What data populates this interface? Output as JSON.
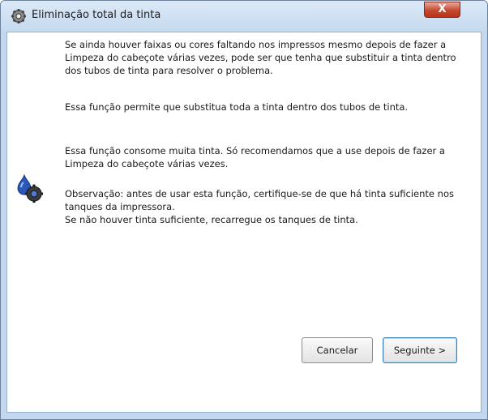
{
  "window": {
    "title": "Eliminação total da tinta",
    "close_label": "X",
    "title_icon": "printer-gear-icon"
  },
  "content": {
    "paragraph1": "Se ainda houver faixas ou cores faltando nos impressos mesmo depois de fazer a Limpeza do cabeçote várias vezes, pode ser que tenha que substituir a tinta dentro dos tubos de tinta para resolver o problema.",
    "paragraph2": "Essa função permite que substitua toda a tinta dentro dos tubos de tinta.",
    "paragraph3": "Essa função consome muita tinta. Só recomendamos que a use depois de fazer a Limpeza do cabeçote várias vezes.",
    "note_line1": "Observação: antes de usar esta função, certifique-se de que há tinta suficiente nos tanques da impressora.",
    "note_line2": "Se não houver tinta suficiente, recarregue os tanques de tinta.",
    "note_icon": "ink-drop-gear-icon"
  },
  "buttons": {
    "cancel": "Cancelar",
    "next": "Seguinte >"
  },
  "colors": {
    "title_bar": "#c5d9ef",
    "close_button": "#c6482f",
    "default_button_border": "#3c7fb1"
  }
}
